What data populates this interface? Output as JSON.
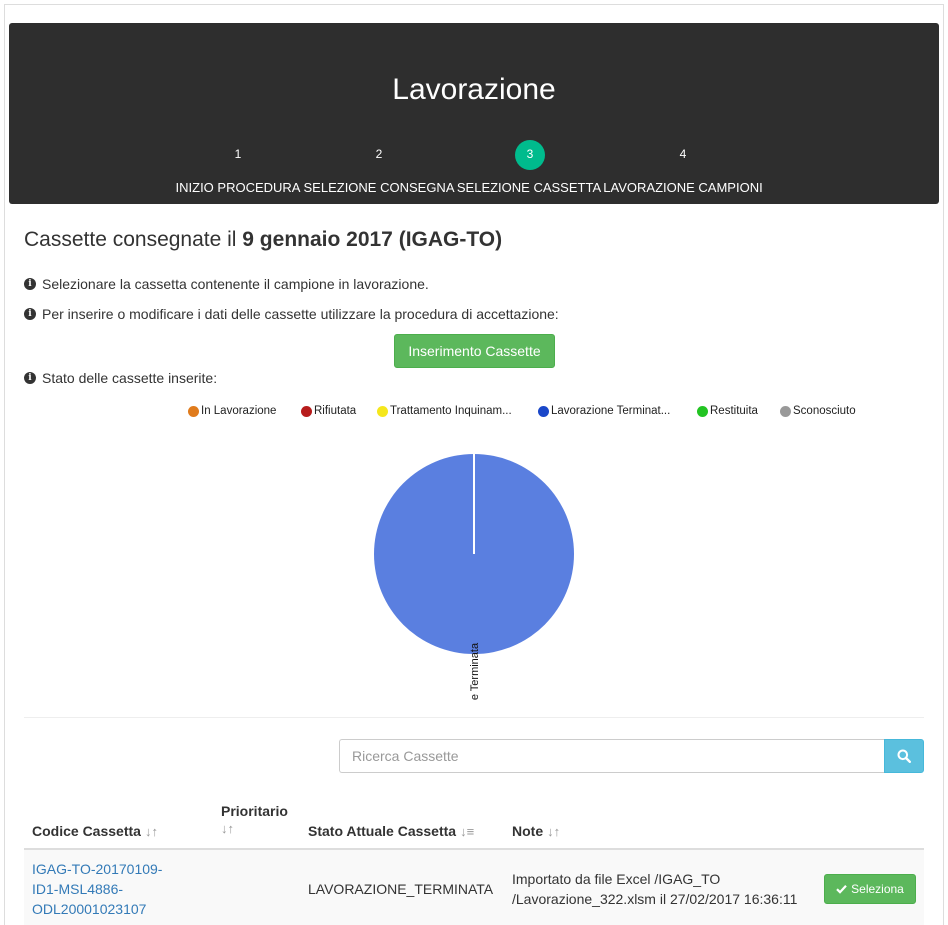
{
  "header": {
    "title": "Lavorazione",
    "steps": [
      {
        "number": "1",
        "label": "INIZIO PROCEDURA",
        "active": false
      },
      {
        "number": "2",
        "label": "SELEZIONE CONSEGNA",
        "active": false
      },
      {
        "number": "3",
        "label": "SELEZIONE CASSETTA",
        "active": true
      },
      {
        "number": "4",
        "label": "LAVORAZIONE CAMPIONI",
        "active": false
      }
    ]
  },
  "main": {
    "title_prefix": "Cassette consegnate il ",
    "title_bold": "9 gennaio 2017 (IGAG-TO)",
    "info_1": "Selezionare la cassetta contenente il campione in lavorazione.",
    "info_2": "Per inserire o modificare i dati delle cassette utilizzare la procedura di accettazione:",
    "insert_button": "Inserimento Cassette",
    "info_3": "Stato delle cassette inserite:"
  },
  "chart_data": {
    "type": "pie",
    "legend": [
      {
        "name": "In Lavorazione",
        "color": "#e07b1c"
      },
      {
        "name": "Rifiutata",
        "color": "#b71c1c"
      },
      {
        "name": "Trattamento Inquinam...",
        "color": "#f5e71c"
      },
      {
        "name": "Lavorazione Terminat...",
        "color": "#1a47c9"
      },
      {
        "name": "Restituita",
        "color": "#22c422"
      },
      {
        "name": "Sconosciuto",
        "color": "#999999"
      }
    ],
    "slices": [
      {
        "name": "Lavorazione Terminata",
        "value": 1,
        "color": "#5a7fe0"
      }
    ],
    "slice_label": "Lavorazione Terminata",
    "legend_position": "top"
  },
  "search": {
    "placeholder": "Ricerca Cassette"
  },
  "table": {
    "columns": [
      {
        "label": "Codice Cassetta"
      },
      {
        "label": "Prioritario"
      },
      {
        "label": "Stato Attuale Cassetta"
      },
      {
        "label": "Note"
      }
    ],
    "rows": [
      {
        "code_lines": [
          "IGAG-TO-20170109-",
          "ID1-MSL4886-",
          "ODL20001023107"
        ],
        "prioritario": "",
        "stato": "LAVORAZIONE_TERMINATA",
        "note_lines": [
          "Importato da file Excel /IGAG_TO",
          "/Lavorazione_322.xlsm il 27/02/2017 16:36:11"
        ],
        "select_label": "Seleziona"
      }
    ]
  }
}
